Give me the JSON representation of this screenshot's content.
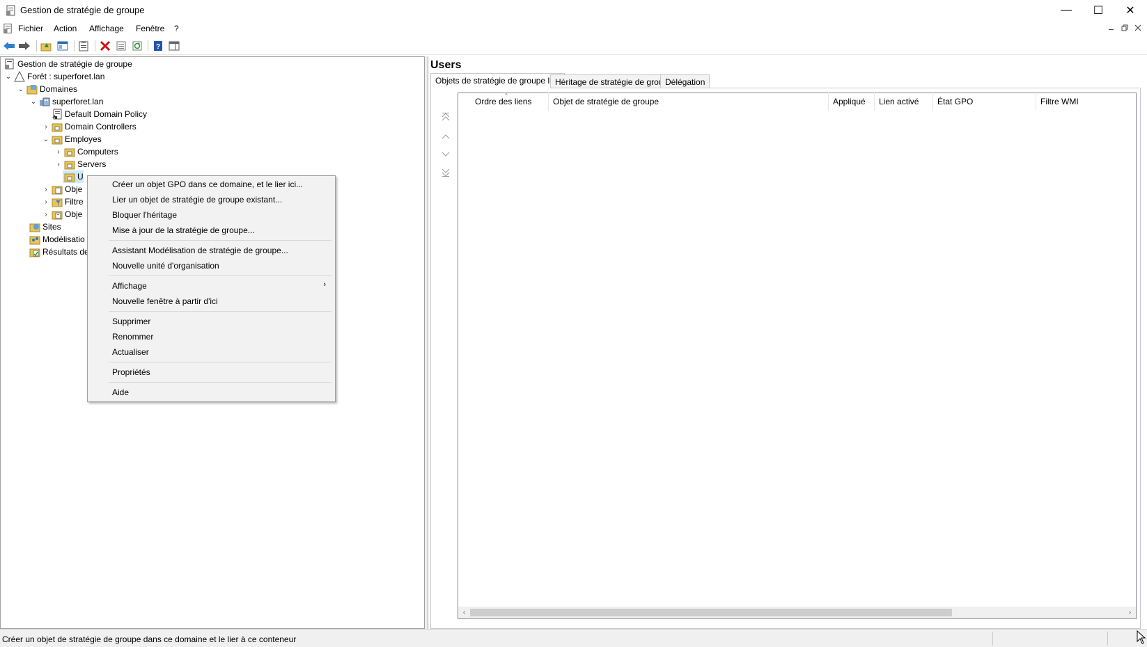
{
  "window": {
    "title": "Gestion de stratégie de groupe",
    "minimize": "—",
    "maximize": "☐",
    "close": "✕"
  },
  "menu": {
    "items": [
      "Fichier",
      "Action",
      "Affichage",
      "Fenêtre",
      "?"
    ]
  },
  "tree": {
    "root": "Gestion de stratégie de groupe",
    "forest": "Forêt : superforet.lan",
    "domains": "Domaines",
    "domain": "superforet.lan",
    "default_policy": "Default Domain Policy",
    "domain_controllers": "Domain Controllers",
    "employes": "Employes",
    "computers": "Computers",
    "servers": "Servers",
    "users_partial": "U",
    "objets_partial": "Obje",
    "filtres_partial": "Filtre",
    "starter_partial": "Obje",
    "sites": "Sites",
    "modelisation_partial": "Modélisatio",
    "resultats_partial": "Résultats de"
  },
  "right": {
    "title": "Users",
    "tabs": [
      "Objets de stratégie de groupe liés",
      "Héritage de stratégie de groupe",
      "Délégation"
    ],
    "columns": [
      "Ordre des liens",
      "Objet de stratégie de groupe",
      "Appliqué",
      "Lien activé",
      "État GPO",
      "Filtre WMI"
    ]
  },
  "context_menu": {
    "items": [
      "Créer un objet GPO dans ce domaine, et le lier ici...",
      "Lier un objet de stratégie de groupe existant...",
      "Bloquer l'héritage",
      "Mise à jour de la stratégie de groupe...",
      "Assistant Modélisation de stratégie de groupe...",
      "Nouvelle unité d'organisation",
      "Affichage",
      "Nouvelle fenêtre à partir d'ici",
      "Supprimer",
      "Renommer",
      "Actualiser",
      "Propriétés",
      "Aide"
    ],
    "submenu_arrow": "›"
  },
  "status": {
    "message": "Créer un objet de stratégie de groupe dans ce domaine et le lier à ce conteneur"
  }
}
